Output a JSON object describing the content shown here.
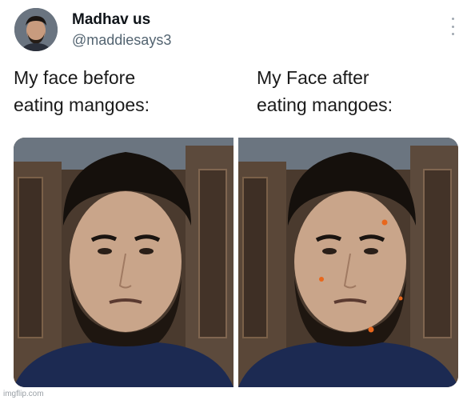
{
  "tweet": {
    "display_name": "Madhav us",
    "handle": "@maddiesays3",
    "more_icon": "more-vertical-icon"
  },
  "captions": {
    "left": "My face before\neating mangoes:",
    "right": "My Face after\neating mangoes:"
  },
  "photos": {
    "left": {
      "description_icon": "face-photo"
    },
    "right": {
      "description_icon": "face-photo-with-pimples",
      "pimple_color": "#e8671c"
    }
  },
  "watermark": "imgflip.com",
  "colors": {
    "name": "#0f1419",
    "handle": "#536471",
    "shirt": "#1c2a52"
  }
}
